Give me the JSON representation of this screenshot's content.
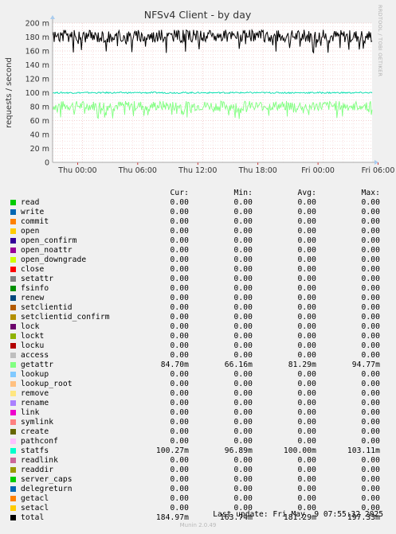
{
  "chart_data": {
    "type": "line",
    "title": "NFSv4 Client - by day",
    "ylabel": "requests / second",
    "ylim": [
      0,
      0.2
    ],
    "yticks": [
      "0",
      "20 m",
      "40 m",
      "60 m",
      "80 m",
      "100 m",
      "120 m",
      "140 m",
      "160 m",
      "180 m",
      "200 m"
    ],
    "xticks": [
      "Thu 00:00",
      "Thu 06:00",
      "Thu 12:00",
      "Thu 18:00",
      "Fri 00:00",
      "Fri 06:00"
    ],
    "grid": true,
    "series": [
      {
        "name": "getattr",
        "color": "#80ff80",
        "mean": 0.08129,
        "min": 0.06616,
        "max": 0.09477
      },
      {
        "name": "statfs",
        "color": "#00e0b0",
        "mean": 0.1,
        "min": 0.09689,
        "max": 0.10311
      },
      {
        "name": "total",
        "color": "#000000",
        "mean": 0.18129,
        "min": 0.16374,
        "max": 0.19733
      }
    ]
  },
  "side_label": "RRDTOOL / TOBI OETIKER",
  "legend": {
    "headers": [
      "Cur:",
      "Min:",
      "Avg:",
      "Max:"
    ],
    "rows": [
      {
        "name": "read",
        "color": "#00cc00",
        "cur": "0.00",
        "min": "0.00",
        "avg": "0.00",
        "max": "0.00"
      },
      {
        "name": "write",
        "color": "#0066b3",
        "cur": "0.00",
        "min": "0.00",
        "avg": "0.00",
        "max": "0.00"
      },
      {
        "name": "commit",
        "color": "#ff8000",
        "cur": "0.00",
        "min": "0.00",
        "avg": "0.00",
        "max": "0.00"
      },
      {
        "name": "open",
        "color": "#ffcc00",
        "cur": "0.00",
        "min": "0.00",
        "avg": "0.00",
        "max": "0.00"
      },
      {
        "name": "open_confirm",
        "color": "#330099",
        "cur": "0.00",
        "min": "0.00",
        "avg": "0.00",
        "max": "0.00"
      },
      {
        "name": "open_noattr",
        "color": "#990099",
        "cur": "0.00",
        "min": "0.00",
        "avg": "0.00",
        "max": "0.00"
      },
      {
        "name": "open_downgrade",
        "color": "#ccff00",
        "cur": "0.00",
        "min": "0.00",
        "avg": "0.00",
        "max": "0.00"
      },
      {
        "name": "close",
        "color": "#ff0000",
        "cur": "0.00",
        "min": "0.00",
        "avg": "0.00",
        "max": "0.00"
      },
      {
        "name": "setattr",
        "color": "#808080",
        "cur": "0.00",
        "min": "0.00",
        "avg": "0.00",
        "max": "0.00"
      },
      {
        "name": "fsinfo",
        "color": "#008f00",
        "cur": "0.00",
        "min": "0.00",
        "avg": "0.00",
        "max": "0.00"
      },
      {
        "name": "renew",
        "color": "#00487d",
        "cur": "0.00",
        "min": "0.00",
        "avg": "0.00",
        "max": "0.00"
      },
      {
        "name": "setclientid",
        "color": "#b35a00",
        "cur": "0.00",
        "min": "0.00",
        "avg": "0.00",
        "max": "0.00"
      },
      {
        "name": "setclientid_confirm",
        "color": "#b38f00",
        "cur": "0.00",
        "min": "0.00",
        "avg": "0.00",
        "max": "0.00"
      },
      {
        "name": "lock",
        "color": "#6b006b",
        "cur": "0.00",
        "min": "0.00",
        "avg": "0.00",
        "max": "0.00"
      },
      {
        "name": "lockt",
        "color": "#8fb300",
        "cur": "0.00",
        "min": "0.00",
        "avg": "0.00",
        "max": "0.00"
      },
      {
        "name": "locku",
        "color": "#b30000",
        "cur": "0.00",
        "min": "0.00",
        "avg": "0.00",
        "max": "0.00"
      },
      {
        "name": "access",
        "color": "#bebebe",
        "cur": "0.00",
        "min": "0.00",
        "avg": "0.00",
        "max": "0.00"
      },
      {
        "name": "getattr",
        "color": "#80ff80",
        "cur": "84.70m",
        "min": "66.16m",
        "avg": "81.29m",
        "max": "94.77m"
      },
      {
        "name": "lookup",
        "color": "#80c9ff",
        "cur": "0.00",
        "min": "0.00",
        "avg": "0.00",
        "max": "0.00"
      },
      {
        "name": "lookup_root",
        "color": "#ffc080",
        "cur": "0.00",
        "min": "0.00",
        "avg": "0.00",
        "max": "0.00"
      },
      {
        "name": "remove",
        "color": "#ffe680",
        "cur": "0.00",
        "min": "0.00",
        "avg": "0.00",
        "max": "0.00"
      },
      {
        "name": "rename",
        "color": "#aa80ff",
        "cur": "0.00",
        "min": "0.00",
        "avg": "0.00",
        "max": "0.00"
      },
      {
        "name": "link",
        "color": "#ee00cc",
        "cur": "0.00",
        "min": "0.00",
        "avg": "0.00",
        "max": "0.00"
      },
      {
        "name": "symlink",
        "color": "#ff8080",
        "cur": "0.00",
        "min": "0.00",
        "avg": "0.00",
        "max": "0.00"
      },
      {
        "name": "create",
        "color": "#666600",
        "cur": "0.00",
        "min": "0.00",
        "avg": "0.00",
        "max": "0.00"
      },
      {
        "name": "pathconf",
        "color": "#ffbfff",
        "cur": "0.00",
        "min": "0.00",
        "avg": "0.00",
        "max": "0.00"
      },
      {
        "name": "statfs",
        "color": "#00ffcc",
        "cur": "100.27m",
        "min": "96.89m",
        "avg": "100.00m",
        "max": "103.11m"
      },
      {
        "name": "readlink",
        "color": "#cc6699",
        "cur": "0.00",
        "min": "0.00",
        "avg": "0.00",
        "max": "0.00"
      },
      {
        "name": "readdir",
        "color": "#999900",
        "cur": "0.00",
        "min": "0.00",
        "avg": "0.00",
        "max": "0.00"
      },
      {
        "name": "server_caps",
        "color": "#00cc00",
        "cur": "0.00",
        "min": "0.00",
        "avg": "0.00",
        "max": "0.00"
      },
      {
        "name": "delegreturn",
        "color": "#0066b3",
        "cur": "0.00",
        "min": "0.00",
        "avg": "0.00",
        "max": "0.00"
      },
      {
        "name": "getacl",
        "color": "#ff8000",
        "cur": "0.00",
        "min": "0.00",
        "avg": "0.00",
        "max": "0.00"
      },
      {
        "name": "setacl",
        "color": "#ffcc00",
        "cur": "0.00",
        "min": "0.00",
        "avg": "0.00",
        "max": "0.00"
      },
      {
        "name": "total",
        "color": "#000000",
        "cur": "184.97m",
        "min": "163.74m",
        "avg": "181.29m",
        "max": "197.33m"
      }
    ]
  },
  "last_update": "Last update: Fri May  9 07:55:32 2025",
  "munin_version": "Munin 2.0.49"
}
